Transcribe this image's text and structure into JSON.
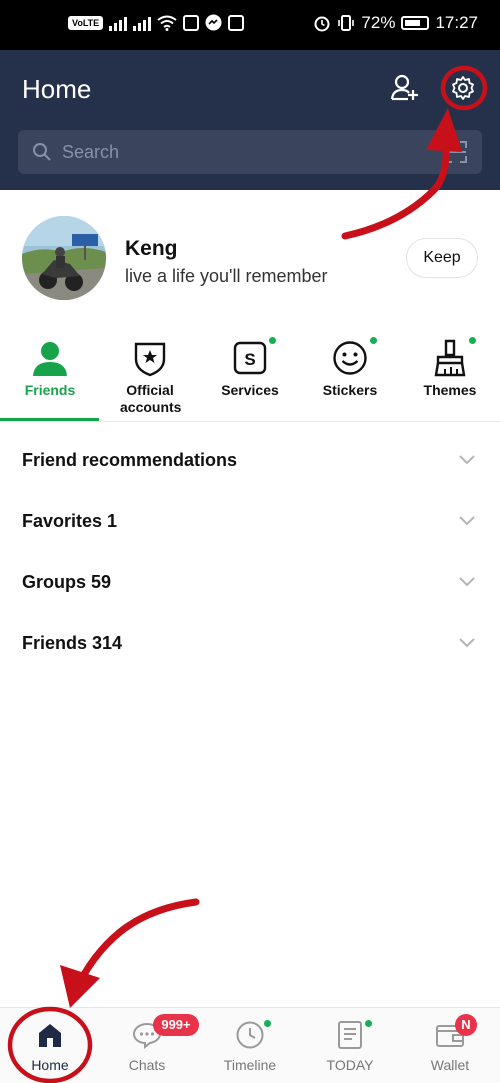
{
  "status_bar": {
    "volte": "VoLTE",
    "battery": "72%",
    "time": "17:27"
  },
  "header": {
    "title": "Home",
    "search_placeholder": "Search"
  },
  "profile": {
    "name": "Keng",
    "status_message": "live a life you'll remember",
    "keep_label": "Keep"
  },
  "categories": [
    {
      "label": "Friends",
      "icon": "person-icon",
      "active": true
    },
    {
      "label": "Official accounts",
      "icon": "shield-star-icon"
    },
    {
      "label": "Services",
      "icon": "services-icon",
      "icon_letter": "S"
    },
    {
      "label": "Stickers",
      "icon": "smiley-icon"
    },
    {
      "label": "Themes",
      "icon": "brush-icon"
    }
  ],
  "lists": [
    {
      "label": "Friend recommendations"
    },
    {
      "label": "Favorites 1"
    },
    {
      "label": "Groups 59"
    },
    {
      "label": "Friends 314"
    }
  ],
  "bottom_nav": [
    {
      "label": "Home",
      "icon": "home-icon",
      "active": true
    },
    {
      "label": "Chats",
      "icon": "chat-icon",
      "badge": "999+"
    },
    {
      "label": "Timeline",
      "icon": "clock-icon"
    },
    {
      "label": "TODAY",
      "icon": "news-icon"
    },
    {
      "label": "Wallet",
      "icon": "wallet-icon",
      "badge": "N"
    }
  ],
  "colors": {
    "header_bg": "#25304a",
    "accent_green": "#16a34a",
    "badge_red": "#e8334a",
    "annotation_red": "#c8101a"
  }
}
